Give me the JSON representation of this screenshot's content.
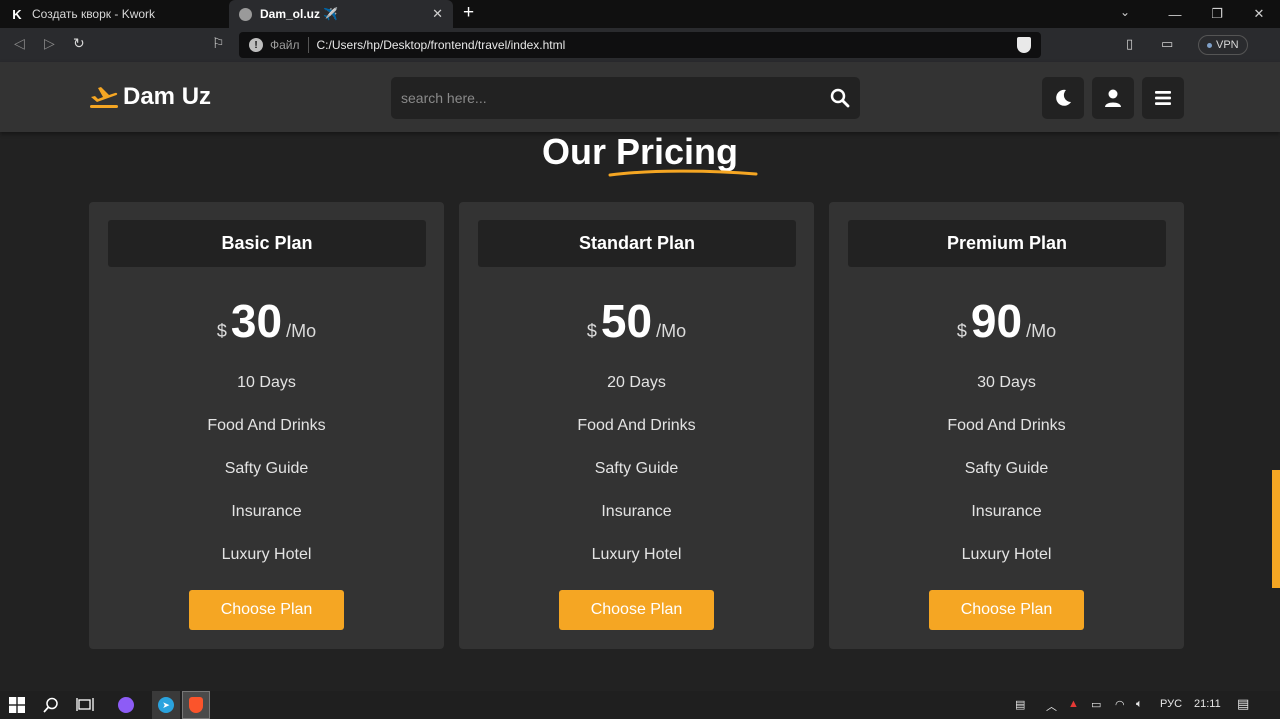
{
  "browser": {
    "tabs": [
      {
        "title": "Создать кворк - Kwork",
        "favicon": "kwork-k-icon",
        "active": false
      },
      {
        "title": "Dam_ol.uz ✈️",
        "favicon": "globe-icon",
        "active": true
      }
    ],
    "address": {
      "scheme": "Файл",
      "url": "C:/Users/hp/Desktop/frontend/travel/index.html"
    },
    "vpn_label": "VPN"
  },
  "site": {
    "brand": "Dam Uz",
    "search": {
      "placeholder": "search here..."
    },
    "header_buttons": [
      "moon-icon",
      "user-icon",
      "menu-icon"
    ],
    "accent_color": "#f5a623"
  },
  "section": {
    "heading_part1": "Our",
    "heading_part2": "Pricing"
  },
  "plans": [
    {
      "name": "Basic Plan",
      "currency": "$",
      "amount": "30",
      "period": "/Mo",
      "features": [
        "10 Days",
        "Food And Drinks",
        "Safty Guide",
        "Insurance",
        "Luxury Hotel"
      ],
      "button": "Choose Plan"
    },
    {
      "name": "Standart Plan",
      "currency": "$",
      "amount": "50",
      "period": "/Mo",
      "features": [
        "20 Days",
        "Food And Drinks",
        "Safty Guide",
        "Insurance",
        "Luxury Hotel"
      ],
      "button": "Choose Plan"
    },
    {
      "name": "Premium Plan",
      "currency": "$",
      "amount": "90",
      "period": "/Mo",
      "features": [
        "30 Days",
        "Food And Drinks",
        "Safty Guide",
        "Insurance",
        "Luxury Hotel"
      ],
      "button": "Choose Plan"
    }
  ],
  "taskbar": {
    "language": "РУС",
    "time": "21:11"
  }
}
